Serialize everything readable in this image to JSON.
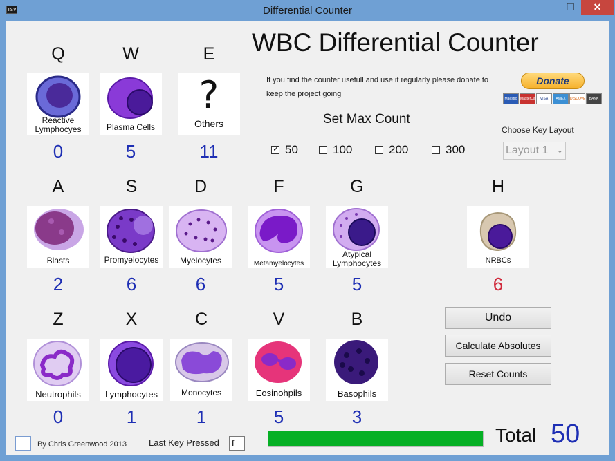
{
  "window": {
    "title": "Differential Counter",
    "icon_text": "TSV"
  },
  "titlebar": {
    "min": "–",
    "max": "☐",
    "close": "✕"
  },
  "app_title": "WBC Differential Counter",
  "donate": {
    "line1": "If you find the counter usefull and use it regularly please donate to",
    "line2": "keep the project going",
    "button": "Donate",
    "cards": [
      "Maestro",
      "MasterCard",
      "VISA",
      "AMEX",
      "DISCOVER",
      "BANK"
    ]
  },
  "max_count": {
    "title": "Set Max Count",
    "options": [
      {
        "label": "50",
        "checked": true
      },
      {
        "label": "100",
        "checked": false
      },
      {
        "label": "200",
        "checked": false
      },
      {
        "label": "300",
        "checked": false
      }
    ]
  },
  "key_layout": {
    "label": "Choose Key Layout",
    "value": "Layout 1"
  },
  "cells": [
    {
      "key": "Q",
      "label": "Reactive Lymphocyes",
      "count": "0"
    },
    {
      "key": "W",
      "label": "Plasma Cells",
      "count": "5"
    },
    {
      "key": "E",
      "label": "Others",
      "count": "11"
    },
    {
      "key": "A",
      "label": "Blasts",
      "count": "2"
    },
    {
      "key": "S",
      "label": "Promyelocytes",
      "count": "6"
    },
    {
      "key": "D",
      "label": "Myelocytes",
      "count": "6"
    },
    {
      "key": "F",
      "label": "Metamyelocytes",
      "count": "5"
    },
    {
      "key": "G",
      "label": "Atypical Lymphocytes",
      "count": "5"
    },
    {
      "key": "H",
      "label": "NRBCs",
      "count": "6"
    },
    {
      "key": "Z",
      "label": "Neutrophils",
      "count": "0"
    },
    {
      "key": "X",
      "label": "Lymphocytes",
      "count": "1"
    },
    {
      "key": "C",
      "label": "Monocytes",
      "count": "1"
    },
    {
      "key": "V",
      "label": "Eosinohpils",
      "count": "5"
    },
    {
      "key": "B",
      "label": "Basophils",
      "count": "3"
    }
  ],
  "buttons": {
    "undo": "Undo",
    "calc": "Calculate Absolutes",
    "reset": "Reset Counts"
  },
  "footer": {
    "author": "By Chris Greenwood 2013",
    "last_key_label": "Last Key Pressed =",
    "last_key_value": "f",
    "progress": 1.0,
    "total_label": "Total",
    "total_value": "50"
  },
  "colors": {
    "count": "#1e2fb4",
    "count_alert": "#d0283a",
    "progress": "#06b025"
  }
}
